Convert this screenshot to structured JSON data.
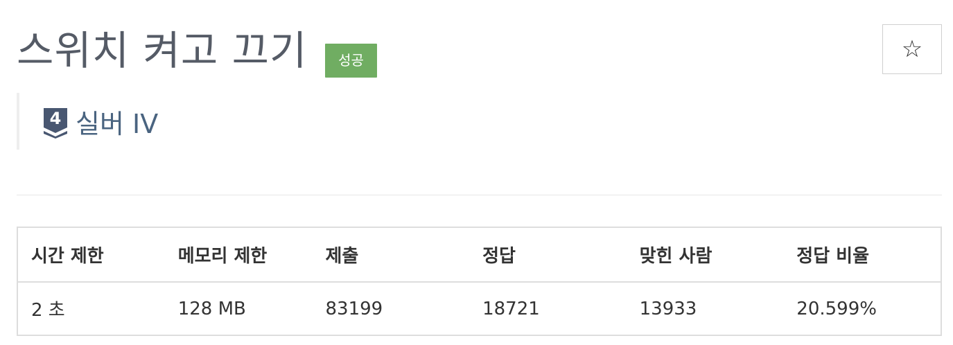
{
  "problem": {
    "title": "스위치 켜고 끄기",
    "result_badge": "성공",
    "star_icon": "star-outline-icon",
    "star_glyph": "☆"
  },
  "tier": {
    "number": "4",
    "label": "실버 IV",
    "icon": "tier-badge-icon",
    "color": "#495771"
  },
  "colors": {
    "badge_success": "#70ad62",
    "title": "#555b66",
    "tier_text": "#4a6480"
  },
  "info_table": {
    "headers": [
      "시간 제한",
      "메모리 제한",
      "제출",
      "정답",
      "맞힌 사람",
      "정답 비율"
    ],
    "row": [
      "2 초",
      "128 MB",
      "83199",
      "18721",
      "13933",
      "20.599%"
    ]
  }
}
